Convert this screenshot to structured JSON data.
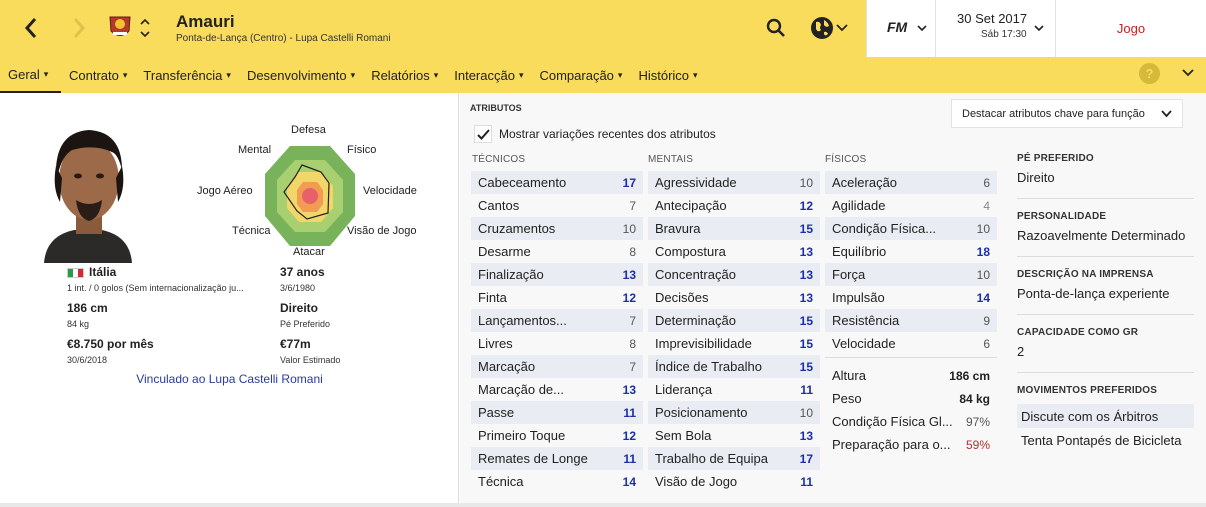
{
  "header": {
    "player_name": "Amauri",
    "player_subtitle": "Ponta-de-Lança (Centro) - Lupa Castelli Romani",
    "date": "30 Set 2017",
    "date_sub": "Sáb 17:30",
    "continue_label": "Jogo",
    "fm_logo": "FM",
    "icons": [
      "back-arrow-icon",
      "forward-arrow-icon",
      "club-crest-icon",
      "search-icon",
      "globe-icon",
      "chevron-down-icon"
    ]
  },
  "nav": {
    "tabs": [
      {
        "label": "Geral"
      },
      {
        "label": "Contrato"
      },
      {
        "label": "Transferência"
      },
      {
        "label": "Desenvolvimento"
      },
      {
        "label": "Relatórios"
      },
      {
        "label": "Interacção"
      },
      {
        "label": "Comparação"
      },
      {
        "label": "Histórico"
      }
    ],
    "help": "?"
  },
  "profile": {
    "radar_labels": {
      "top": "Defesa",
      "top_left": "Mental",
      "top_right": "Físico",
      "left": "Jogo Aéreo",
      "right": "Velocidade",
      "bottom_left": "Técnica",
      "bottom_right": "Visão de Jogo",
      "bottom": "Atacar"
    },
    "nationality": "Itália",
    "caps": "1 int. / 0 golos (Sem internacionalização ju...",
    "age": "37 anos",
    "dob": "3/6/1980",
    "height": "186 cm",
    "weight": "84 kg",
    "foot": "Direito",
    "foot_label": "Pé Preferido",
    "wage": "€8.750 por mês",
    "contract_end": "30/6/2018",
    "value": "€77m",
    "value_label": "Valor Estimado",
    "club_link": "Vinculado ao Lupa Castelli Romani"
  },
  "attributes": {
    "title": "ATRIBUTOS",
    "show_changes": "Mostrar variações recentes dos atributos",
    "highlight_select": "Destacar atributos chave para função",
    "technical_head": "TÉCNICOS",
    "mental_head": "MENTAIS",
    "physical_head": "FÍSICOS",
    "technical": [
      {
        "name": "Cabeceamento",
        "value": "17"
      },
      {
        "name": "Cantos",
        "value": "7"
      },
      {
        "name": "Cruzamentos",
        "value": "10"
      },
      {
        "name": "Desarme",
        "value": "8"
      },
      {
        "name": "Finalização",
        "value": "13"
      },
      {
        "name": "Finta",
        "value": "12"
      },
      {
        "name": "Lançamentos...",
        "value": "7"
      },
      {
        "name": "Livres",
        "value": "8"
      },
      {
        "name": "Marcação",
        "value": "7"
      },
      {
        "name": "Marcação de...",
        "value": "13"
      },
      {
        "name": "Passe",
        "value": "11"
      },
      {
        "name": "Primeiro Toque",
        "value": "12"
      },
      {
        "name": "Remates de Longe",
        "value": "11"
      },
      {
        "name": "Técnica",
        "value": "14"
      }
    ],
    "mental": [
      {
        "name": "Agressividade",
        "value": "10"
      },
      {
        "name": "Antecipação",
        "value": "12"
      },
      {
        "name": "Bravura",
        "value": "15"
      },
      {
        "name": "Compostura",
        "value": "13"
      },
      {
        "name": "Concentração",
        "value": "13"
      },
      {
        "name": "Decisões",
        "value": "13"
      },
      {
        "name": "Determinação",
        "value": "15"
      },
      {
        "name": "Imprevisibilidade",
        "value": "15"
      },
      {
        "name": "Índice de Trabalho",
        "value": "15"
      },
      {
        "name": "Liderança",
        "value": "11"
      },
      {
        "name": "Posicionamento",
        "value": "10"
      },
      {
        "name": "Sem Bola",
        "value": "13"
      },
      {
        "name": "Trabalho de Equipa",
        "value": "17"
      },
      {
        "name": "Visão de Jogo",
        "value": "11"
      }
    ],
    "physical": [
      {
        "name": "Aceleração",
        "value": "6"
      },
      {
        "name": "Agilidade",
        "value": "4"
      },
      {
        "name": "Condição Física...",
        "value": "10"
      },
      {
        "name": "Equilíbrio",
        "value": "18"
      },
      {
        "name": "Força",
        "value": "10"
      },
      {
        "name": "Impulsão",
        "value": "14"
      },
      {
        "name": "Resistência",
        "value": "9"
      },
      {
        "name": "Velocidade",
        "value": "6"
      }
    ],
    "extra": [
      {
        "name": "Altura",
        "value": "186 cm"
      },
      {
        "name": "Peso",
        "value": "84 kg"
      },
      {
        "name": "Condição Física Gl...",
        "value": "97%"
      },
      {
        "name": "Preparação para o...",
        "value": "59%"
      }
    ]
  },
  "info": {
    "foot_label": "PÉ PREFERIDO",
    "foot_value": "Direito",
    "personality_label": "PERSONALIDADE",
    "personality_value": "Razoavelmente Determinado",
    "press_label": "DESCRIÇÃO NA IMPRENSA",
    "press_value": "Ponta-de-lança experiente",
    "gk_label": "CAPACIDADE COMO GR",
    "gk_value": "2",
    "moves_label": "MOVIMENTOS PREFERIDOS",
    "moves": [
      "Discute com os Árbitros",
      "Tenta Pontapés de Bicicleta"
    ]
  },
  "colors": {
    "accent_yellow": "#f9dc5c",
    "value_blue": "#1b2fa8",
    "value_grey": "#555555",
    "value_light": "#888888",
    "value_red": "#b03030",
    "link_blue": "#2a3aa0",
    "continue_red": "#c81e1e"
  }
}
